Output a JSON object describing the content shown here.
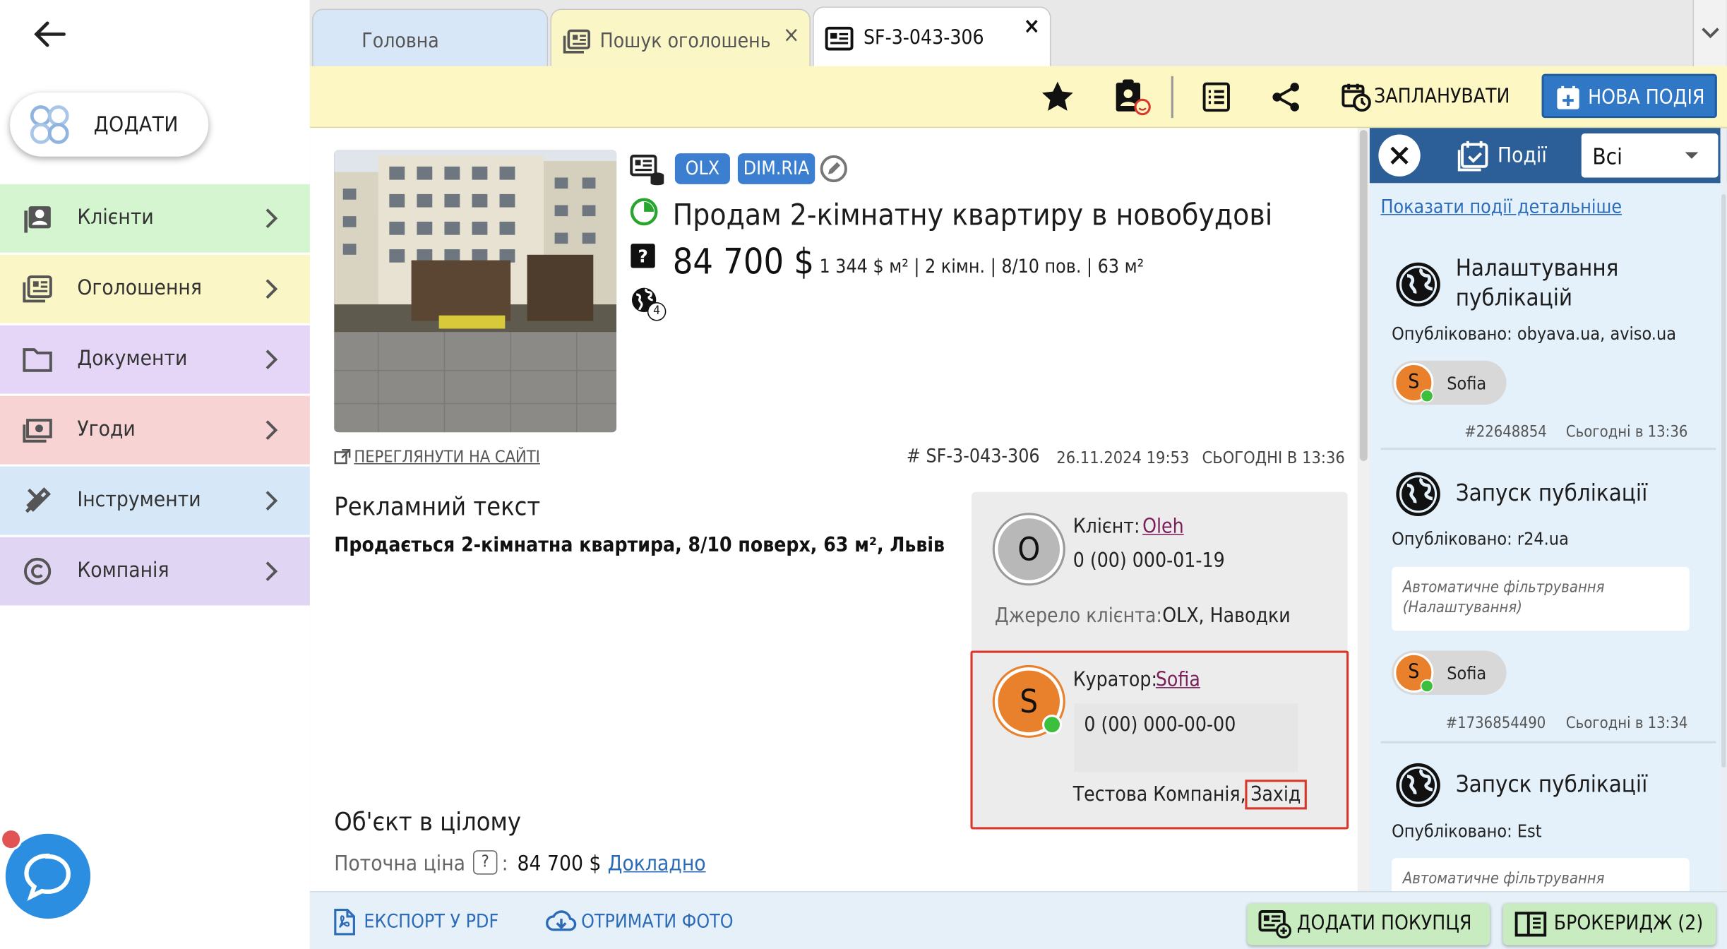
{
  "sidebar": {
    "add_label": "ДОДАТИ",
    "items": [
      {
        "label": "Клієнти",
        "color": "#d5f5d0",
        "icon": "contacts-icon"
      },
      {
        "label": "Оголошення",
        "color": "#fbf6c5",
        "icon": "listing-icon"
      },
      {
        "label": "Документи",
        "color": "#e5d6f7",
        "icon": "folder-icon"
      },
      {
        "label": "Угоди",
        "color": "#f7d3d3",
        "icon": "money-icon"
      },
      {
        "label": "Інструменти",
        "color": "#d6e7f8",
        "icon": "tools-icon"
      },
      {
        "label": "Компанія",
        "color": "#e0d6f4",
        "icon": "copyright-icon"
      }
    ]
  },
  "tabs": [
    {
      "label": "Головна"
    },
    {
      "label": "Пошук оголошень",
      "close": "×"
    },
    {
      "label": "SF-3-043-306",
      "close": "×"
    }
  ],
  "toolbar": {
    "schedule_label": "ЗАПЛАНУВАТИ",
    "new_event_label": "НОВА ПОДІЯ"
  },
  "listing": {
    "sources": [
      "OLX",
      "DIM.RIA"
    ],
    "photo_badge": "4",
    "title": "Продам 2-кімнатну квартиру в новобудові",
    "price": "84 700 $",
    "specs": "1 344 $ м² | 2 кімн. | 8/10 пов. | 63 м²",
    "view_site": "ПЕРЕГЛЯНУТИ НА САЙТІ",
    "id": "# SF-3-043-306",
    "created": "26.11.2024 19:53",
    "updated": "СЬОГОДНІ В 13:36",
    "ad_heading": "Рекламний текст",
    "ad_text": "Продається 2-кімнатна квартира, 8/10 поверх, 63 м², Львів",
    "object_heading": "Об'єкт в цілому",
    "current_price_label": "Поточна ціна",
    "current_price_q": "?",
    "current_price_colon": ":",
    "current_price_value": "84 700 $",
    "details_link": "Докладно"
  },
  "client": {
    "initial": "O",
    "label": "Клієнт:",
    "name": "Oleh",
    "phone": "0 (00) 000-01-19",
    "source_label": "Джерело клієнта:",
    "source_value": "OLX, Наводки"
  },
  "curator": {
    "initial": "S",
    "label": "Куратор:",
    "name": "Sofia",
    "phone": "0 (00) 000-00-00",
    "company": "Тестова Компанія,",
    "region": "Захід"
  },
  "events": {
    "tab_label": "Події",
    "filter": "Всі",
    "details_link": "Показати події детальніше",
    "items": [
      {
        "title": "Налаштування публікацій",
        "published": "Опубліковано: obyava.ua, aviso.ua",
        "note": "",
        "user_initial": "S",
        "user": "Sofia",
        "number": "#22648854",
        "time": "Сьогодні в 13:36"
      },
      {
        "title": "Запуск публікації",
        "published": "Опубліковано: r24.ua",
        "note": "Автоматичне фільтрування (Налаштування)",
        "user_initial": "S",
        "user": "Sofia",
        "number": "#1736854490",
        "time": "Сьогодні в 13:34"
      },
      {
        "title": "Запуск публікації",
        "published": "Опубліковано: Est",
        "note": "Автоматичне фільтрування",
        "user_initial": "",
        "user": "",
        "number": "",
        "time": ""
      }
    ]
  },
  "bottom": {
    "export_label": "ЕКСПОРТ У PDF",
    "photos_label": "ОТРИМАТИ ФОТО",
    "add_buyer_label": "ДОДАТИ ПОКУПЦЯ",
    "brokerage_label": "БРОКЕРИДЖ (2)"
  },
  "colors": {
    "accent_blue": "#2c5f97",
    "chip_blue": "#3c7fd1",
    "orange": "#e8802c",
    "online": "#3cbf3c",
    "highlight_red": "#d9372a"
  }
}
